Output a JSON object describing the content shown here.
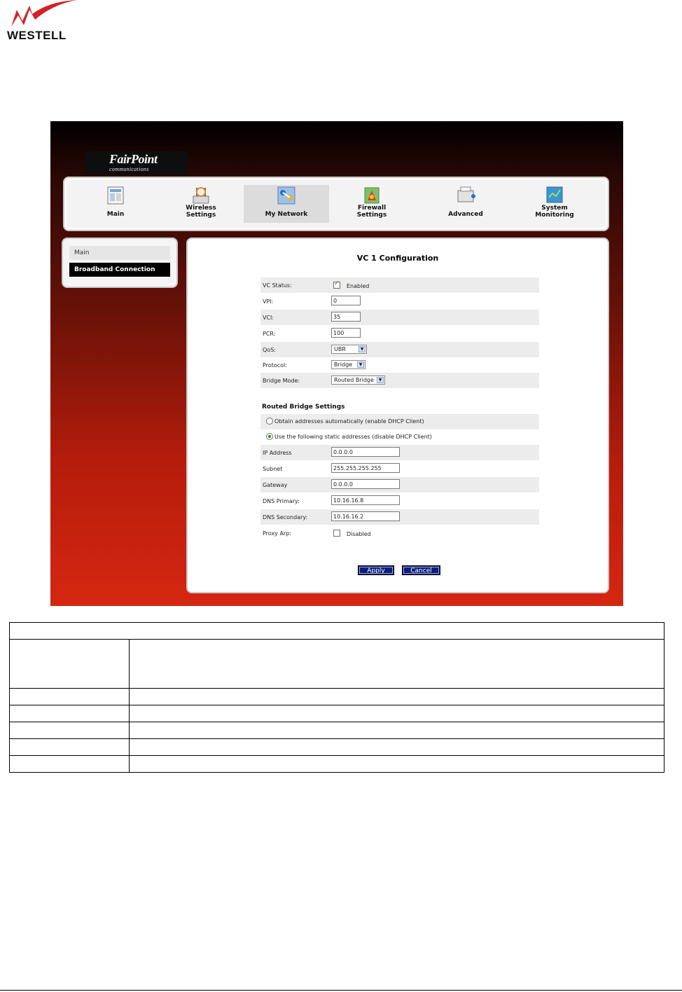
{
  "doc_logo": {
    "word": "WESTELL",
    "accent": "#d2222a"
  },
  "brand": {
    "name": "FairPoint",
    "tagline": "communications"
  },
  "nav": {
    "items": [
      {
        "label_line1": "Main",
        "label_line2": "",
        "icon": "main-icon"
      },
      {
        "label_line1": "Wireless",
        "label_line2": "Settings",
        "icon": "wireless-icon"
      },
      {
        "label_line1": "My Network",
        "label_line2": "",
        "icon": "network-icon"
      },
      {
        "label_line1": "Firewall",
        "label_line2": "Settings",
        "icon": "firewall-icon"
      },
      {
        "label_line1": "Advanced",
        "label_line2": "",
        "icon": "advanced-icon"
      },
      {
        "label_line1": "System",
        "label_line2": "Monitoring",
        "icon": "monitoring-icon"
      }
    ],
    "active": "My Network"
  },
  "sidebar": {
    "items": [
      "Main",
      "Broadband Connection"
    ],
    "active": "Broadband Connection"
  },
  "form": {
    "title": "VC 1 Configuration",
    "vc_status": {
      "label": "VC Status:",
      "checkbox_label": "Enabled",
      "checked": true
    },
    "vpi": {
      "label": "VPI:",
      "value": "0"
    },
    "vci": {
      "label": "VCI:",
      "value": "35"
    },
    "pcr": {
      "label": "PCR:",
      "value": "100"
    },
    "qos": {
      "label": "QoS:",
      "value": "UBR"
    },
    "protocol": {
      "label": "Protocol:",
      "value": "Bridge"
    },
    "bridge_mode": {
      "label": "Bridge Mode:",
      "value": "Routed Bridge"
    },
    "routed_title": "Routed Bridge Settings",
    "radio_auto": "Obtain addresses automatically (enable DHCP Client)",
    "radio_static": "Use the following static addresses (disable DHCP Client)",
    "ip": {
      "label": "IP Address",
      "value": "0.0.0.0"
    },
    "subnet": {
      "label": "Subnet",
      "value": "255.255.255.255"
    },
    "gateway": {
      "label": "Gateway",
      "value": "0.0.0.0"
    },
    "dns1": {
      "label": "DNS Primary:",
      "value": "10.16.16.8"
    },
    "dns2": {
      "label": "DNS Secondary:",
      "value": "10.16.16.2"
    },
    "proxy_arp": {
      "label": "Proxy Arp:",
      "checkbox_label": "Disabled",
      "checked": false
    },
    "apply": "Apply",
    "cancel": "Cancel"
  },
  "colors": {
    "button": "#0c1f78",
    "sidebar_active": "#000000",
    "bg_top": "#000000",
    "bg_bottom": "#d52711"
  }
}
